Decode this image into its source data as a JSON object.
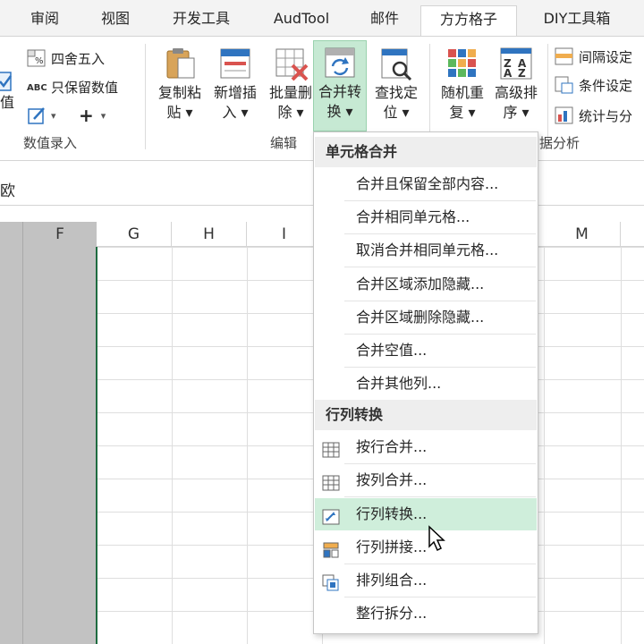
{
  "tabs": [
    {
      "label": "审阅",
      "active": false
    },
    {
      "label": "视图",
      "active": false
    },
    {
      "label": "开发工具",
      "active": false
    },
    {
      "label": "AudTool",
      "active": false
    },
    {
      "label": "邮件",
      "active": false
    },
    {
      "label": "方方格子",
      "active": true
    },
    {
      "label": "DIY工具箱",
      "active": false
    }
  ],
  "ribbon": {
    "value_entry": {
      "partial_label": "值",
      "round_label": "四舍五入",
      "keep_values_label": "只保留数值",
      "plus_label": "+",
      "group_label": "数值录入"
    },
    "edit": {
      "copy_paste": {
        "line1": "复制粘",
        "line2": "贴 ▾"
      },
      "add_insert": {
        "line1": "新增插",
        "line2": "入 ▾"
      },
      "batch_delete": {
        "line1": "批量删",
        "line2": "除 ▾"
      },
      "merge_convert": {
        "line1": "合并转",
        "line2": "换 ▾"
      },
      "find_locate": {
        "line1": "查找定",
        "line2": "位 ▾"
      },
      "group_label": "编辑"
    },
    "data_analysis": {
      "random_repeat": {
        "line1": "随机重",
        "line2": "复 ▾"
      },
      "advanced_sort": {
        "line1": "高级排",
        "line2": "序 ▾"
      },
      "interval_setting": "间隔设定",
      "condition_setting": "条件设定",
      "stats_split": "统计与分",
      "group_label": "据分析"
    }
  },
  "formula_bar": {
    "value": "欧"
  },
  "columns": [
    "F",
    "G",
    "H",
    "I",
    "M"
  ],
  "menu": {
    "section1_title": "单元格合并",
    "section1_items": [
      "合并且保留全部内容...",
      "合并相同单元格...",
      "取消合并相同单元格...",
      "合并区域添加隐藏...",
      "合并区域删除隐藏...",
      "合并空值...",
      "合并其他列..."
    ],
    "section2_title": "行列转换",
    "section2_items": [
      {
        "label": "按行合并...",
        "icon": "grid-rows-icon"
      },
      {
        "label": "按列合并...",
        "icon": "grid-cols-icon"
      },
      {
        "label": "行列转换...",
        "icon": "transpose-icon",
        "hover": true
      },
      {
        "label": "行列拼接...",
        "icon": "splice-icon"
      },
      {
        "label": "排列组合...",
        "icon": "combination-icon"
      },
      {
        "label": "整行拆分...",
        "icon": ""
      }
    ]
  },
  "colors": {
    "accent_green": "#1e6b40",
    "hover_green": "#cfeedb",
    "active_button": "#c6e9d3",
    "selected_column": "#c2c2c2"
  }
}
